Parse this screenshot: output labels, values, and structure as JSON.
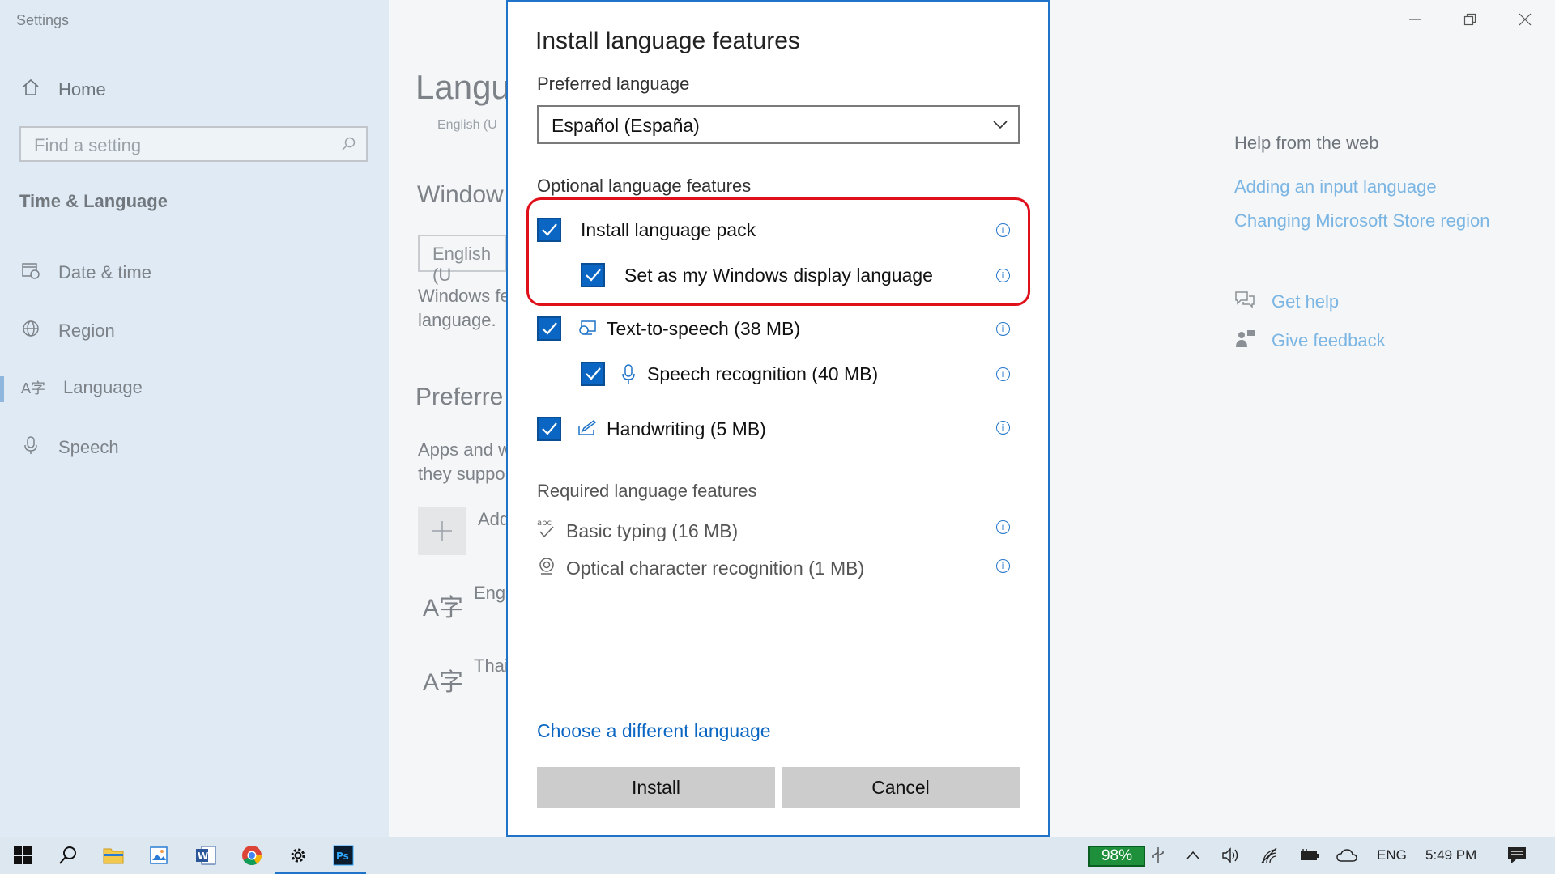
{
  "window": {
    "app_title": "Settings"
  },
  "sidebar": {
    "home_label": "Home",
    "search_placeholder": "Find a setting",
    "section_title": "Time & Language",
    "items": [
      {
        "label": "Date & time",
        "icon": "calendar-clock-icon"
      },
      {
        "label": "Region",
        "icon": "globe-icon"
      },
      {
        "label": "Language",
        "icon": "language-icon",
        "active": true
      },
      {
        "label": "Speech",
        "icon": "microphone-icon"
      }
    ]
  },
  "main_background": {
    "page_title": "Langu",
    "page_subtitle": "English (U",
    "windows_heading": "Window",
    "windows_dropdown": "English (U",
    "windows_text_1": "Windows fe",
    "windows_text_2": "language.",
    "preferred_heading": "Preferre",
    "apps_text_1": "Apps and w",
    "apps_text_2": "they suppo",
    "add_label": "Add",
    "lang_items": [
      "Eng",
      "Thai"
    ]
  },
  "help": {
    "title": "Help from the web",
    "links": [
      "Adding an input language",
      "Changing Microsoft Store region"
    ],
    "get_help": "Get help",
    "give_feedback": "Give feedback"
  },
  "dialog": {
    "title": "Install language features",
    "preferred_language_label": "Preferred language",
    "preferred_language_value": "Español (España)",
    "optional_heading": "Optional language features",
    "optional_features": [
      {
        "label": "Install language pack",
        "checked": true
      },
      {
        "label": "Set as my Windows display language",
        "checked": true
      },
      {
        "label": "Text-to-speech (38 MB)",
        "checked": true,
        "icon": "speech-monitor-icon"
      },
      {
        "label": "Speech recognition (40 MB)",
        "checked": true,
        "icon": "microphone-icon"
      },
      {
        "label": "Handwriting (5 MB)",
        "checked": true,
        "icon": "pen-icon"
      }
    ],
    "required_heading": "Required language features",
    "required_features": [
      {
        "label": "Basic typing (16 MB)",
        "icon": "abc-check-icon"
      },
      {
        "label": "Optical character recognition (1 MB)",
        "icon": "camera-icon"
      }
    ],
    "choose_different": "Choose a different language",
    "install_button": "Install",
    "cancel_button": "Cancel",
    "highlight_color": "#e0101a",
    "accent_color": "#0a66c2"
  },
  "taskbar": {
    "battery_percent": "98%",
    "input_lang": "ENG",
    "time": "5:49 PM",
    "app_icons": [
      "windows-start-icon",
      "search-icon",
      "file-explorer-icon",
      "photos-icon",
      "word-icon",
      "chrome-icon",
      "settings-icon",
      "photoshop-icon"
    ]
  }
}
